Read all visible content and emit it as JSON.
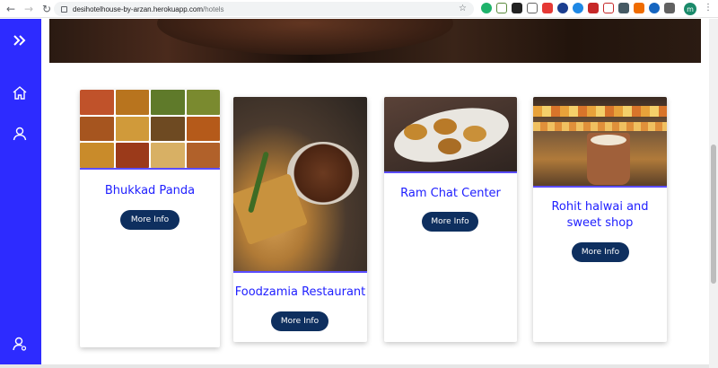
{
  "browser": {
    "url_host": "desihotelhouse-by-arzan.herokuapp.com",
    "url_path": "/hotels",
    "profile_initial": "m"
  },
  "colors": {
    "sidebar": "#2d2bff",
    "title": "#2020ff",
    "button": "#0e2f5f"
  },
  "sidebar": {
    "icons": [
      "double-chevron-right-icon",
      "home-icon",
      "user-icon",
      "user-settings-icon"
    ]
  },
  "cards": [
    {
      "title": "Bhukkad Panda",
      "button": "More Info",
      "image": "assorted-food-grid"
    },
    {
      "title": "Foodzamia Restaurant",
      "button": "More Info",
      "image": "samosa-plate"
    },
    {
      "title": "Ram Chat Center",
      "button": "More Info",
      "image": "chaat-plate"
    },
    {
      "title": "Rohit halwai and sweet shop",
      "button": "More Info",
      "image": "sweet-shop-display"
    }
  ]
}
